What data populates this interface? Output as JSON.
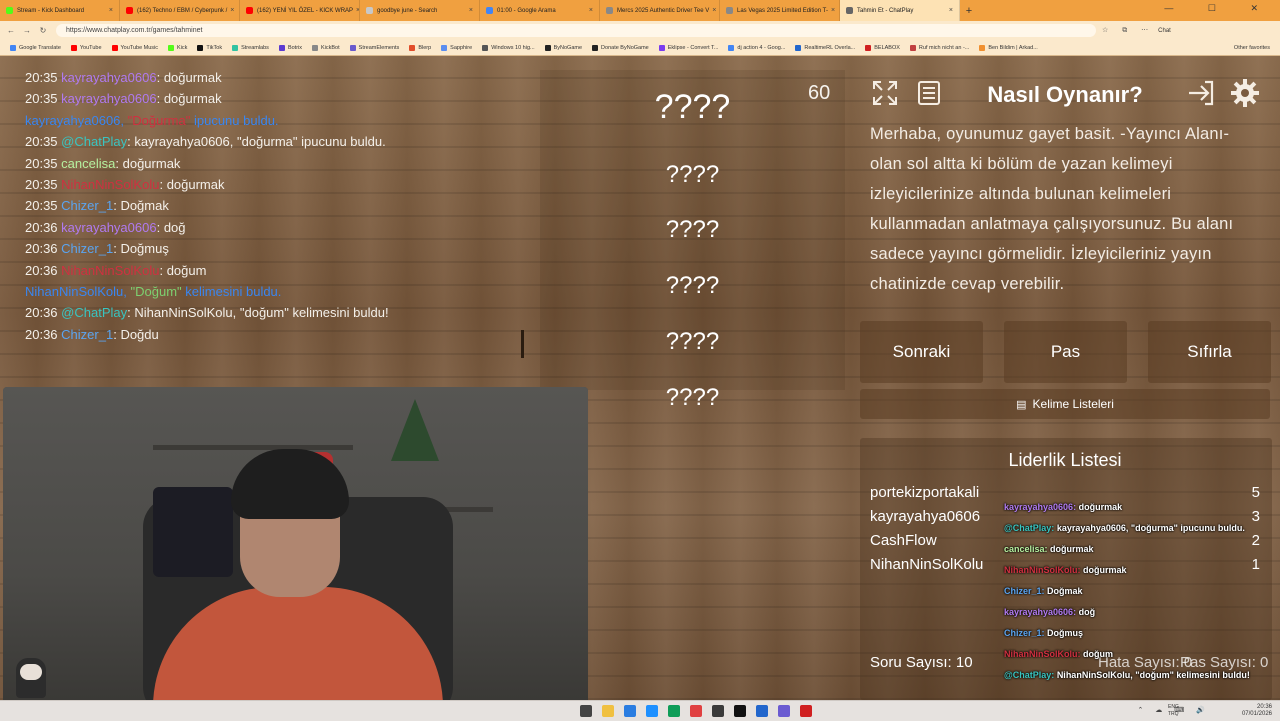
{
  "browser": {
    "tabs": [
      {
        "label": "Stream - Kick Dashboard",
        "color": "#53fc18"
      },
      {
        "label": "(162) Techno / EBM / Cyberpunk /",
        "color": "#ff0000"
      },
      {
        "label": "(162) YENİ YIL ÖZEL - KICK WRAP",
        "color": "#ff0000"
      },
      {
        "label": "goodbye june - Search",
        "color": "#c8c8c8"
      },
      {
        "label": "01:00 - Google Arama",
        "color": "#4285f4"
      },
      {
        "label": "Mercs 2025 Authentic Driver Tee V",
        "color": "#888888"
      },
      {
        "label": "Las Vegas 2025 Limited Edition T-",
        "color": "#888888"
      },
      {
        "label": "Tahmin Et - ChatPlay",
        "color": "#666666",
        "active": true
      }
    ],
    "url": "https://www.chatplay.com.tr/games/tahminet",
    "bookmarks": [
      "Google Translate",
      "YouTube",
      "YouTube Music",
      "Kick",
      "TikTok",
      "Streamlabs",
      "Botrix",
      "KickBot",
      "StreamElements",
      "Blerp",
      "Sapphire",
      "Windows 10 hig...",
      "ByNoGame",
      "Donate ByNoGame",
      "Eklipse - Convert T...",
      "dj action 4 - Goog...",
      "RealtimeRL Overla...",
      "BELABOX",
      "Ruf mich nicht an -...",
      "Ben Bildim | Arkad..."
    ],
    "other_favorites": "Other favorites",
    "chat_label": "Chat"
  },
  "chat": [
    {
      "time": "20:35",
      "user": "kayrayahya0606",
      "color": "purple",
      "msg": "doğurmak"
    },
    {
      "time": "20:35",
      "user": "kayrayahya0606",
      "color": "purple",
      "msg": "doğurmak"
    },
    {
      "time": "",
      "user": "kayrayahya0606,",
      "color": "bluelink",
      "msg": "ipucunu buldu.",
      "highlight": "\"Doğurma\"",
      "system": true
    },
    {
      "time": "20:35",
      "user": "@ChatPlay",
      "color": "cyan",
      "msg": "kayrayahya0606, \"doğurma\" ipucunu buldu."
    },
    {
      "time": "20:35",
      "user": "cancelisa",
      "color": "lgreen",
      "msg": "doğurmak"
    },
    {
      "time": "20:35",
      "user": "NihanNinSolKolu",
      "color": "red",
      "msg": "doğurmak"
    },
    {
      "time": "20:35",
      "user": "Chizer_1",
      "color": "blue",
      "msg": "Doğmak"
    },
    {
      "time": "20:36",
      "user": "kayrayahya0606",
      "color": "purple",
      "msg": "doğ"
    },
    {
      "time": "20:36",
      "user": "Chizer_1",
      "color": "blue",
      "msg": "Doğmuş"
    },
    {
      "time": "20:36",
      "user": "NihanNinSolKolu",
      "color": "red",
      "msg": "doğum"
    },
    {
      "time": "",
      "user": "NihanNinSolKolu,",
      "color": "bluelink",
      "msg": "kelimesini buldu.",
      "highlight": "\"Doğum\"",
      "system": true
    },
    {
      "time": "20:36",
      "user": "@ChatPlay",
      "color": "cyan",
      "msg": "NihanNinSolKolu, \"doğum\" kelimesini buldu!"
    },
    {
      "time": "20:36",
      "user": "Chizer_1",
      "color": "blue",
      "msg": "Doğdu"
    }
  ],
  "game": {
    "timer": "60",
    "hidden_words": [
      "????",
      "????",
      "????",
      "????",
      "????",
      "????"
    ]
  },
  "help": {
    "title": "Nasıl Oynanır?",
    "description": "Merhaba, oyunumuz gayet basit. -Yayıncı Alanı- olan sol altta ki bölüm de yazan kelimeyi izleyicilerinize altında bulunan kelimeleri kullanmadan anlatmaya çalışıyorsunuz. Bu alanı sadece yayıncı görmelidir. İzleyicileriniz yayın chatinizde cevap verebilir."
  },
  "icons": {
    "fullscreen": "fullscreen-icon",
    "notes": "notes-icon",
    "exit": "exit-icon",
    "settings": "gear-icon"
  },
  "buttons": {
    "next": "Sonraki",
    "pass": "Pas",
    "reset": "Sıfırla",
    "word_lists": "Kelime Listeleri"
  },
  "leaderboard": {
    "title": "Liderlik Listesi",
    "rows": [
      {
        "name": "portekizportakali",
        "score": "5"
      },
      {
        "name": "kayrayahya0606",
        "score": "3"
      },
      {
        "name": "CashFlow",
        "score": "2"
      },
      {
        "name": "NihanNinSolKolu",
        "score": "1"
      }
    ]
  },
  "stats": {
    "questions": "Soru Sayısı: 10",
    "errors": "Hata Sayısı: 0",
    "passes": "Pas Sayısı: 0"
  },
  "overlay_chat": [
    {
      "user": "kayrayahya0606:",
      "color": "purple",
      "msg": "doğurmak"
    },
    {
      "user": "@ChatPlay:",
      "color": "cyan",
      "msg": "kayrayahya0606, \"doğurma\" ipucunu buldu."
    },
    {
      "user": "cancelisa:",
      "color": "lgreen",
      "msg": "doğurmak"
    },
    {
      "user": "NihanNinSolKolu:",
      "color": "red",
      "msg": "doğurmak"
    },
    {
      "user": "Chizer_1:",
      "color": "blue",
      "msg": "Doğmak"
    },
    {
      "user": "kayrayahya0606:",
      "color": "purple",
      "msg": "doğ"
    },
    {
      "user": "Chizer_1:",
      "color": "blue",
      "msg": "Doğmuş"
    },
    {
      "user": "NihanNinSolKolu:",
      "color": "red",
      "msg": "doğum"
    },
    {
      "user": "@ChatPlay:",
      "color": "cyan",
      "msg": "NihanNinSolKolu, \"doğum\" kelimesini buldu!"
    }
  ],
  "taskbar": {
    "lang": "ENG TRQ",
    "time": "20:36",
    "date": "07/01/2026"
  }
}
